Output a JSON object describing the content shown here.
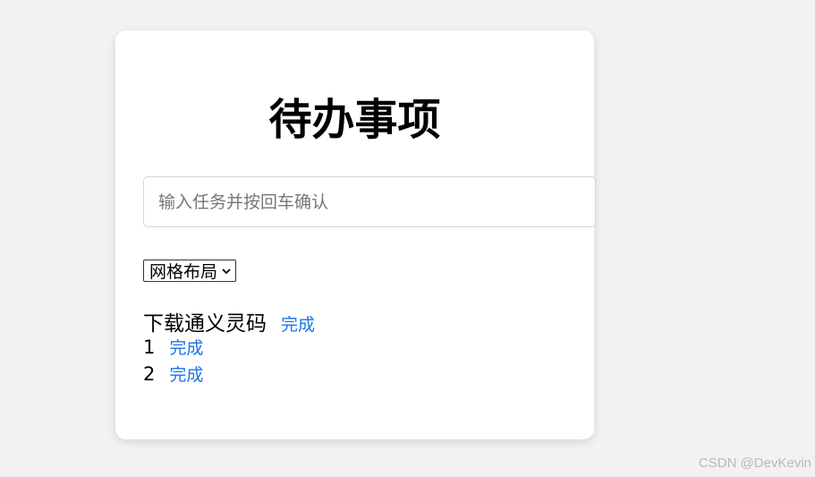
{
  "title": "待办事项",
  "input": {
    "placeholder": "输入任务并按回车确认",
    "value": ""
  },
  "layout_select": {
    "selected": "网格布局"
  },
  "todos": [
    {
      "text": "下载通义灵码",
      "action": "完成"
    },
    {
      "text": "1",
      "action": "完成"
    },
    {
      "text": "2",
      "action": "完成"
    }
  ],
  "watermark": "CSDN @DevKevin",
  "colors": {
    "link": "#1a73e8",
    "background": "#f2f2f2",
    "card": "#ffffff"
  }
}
